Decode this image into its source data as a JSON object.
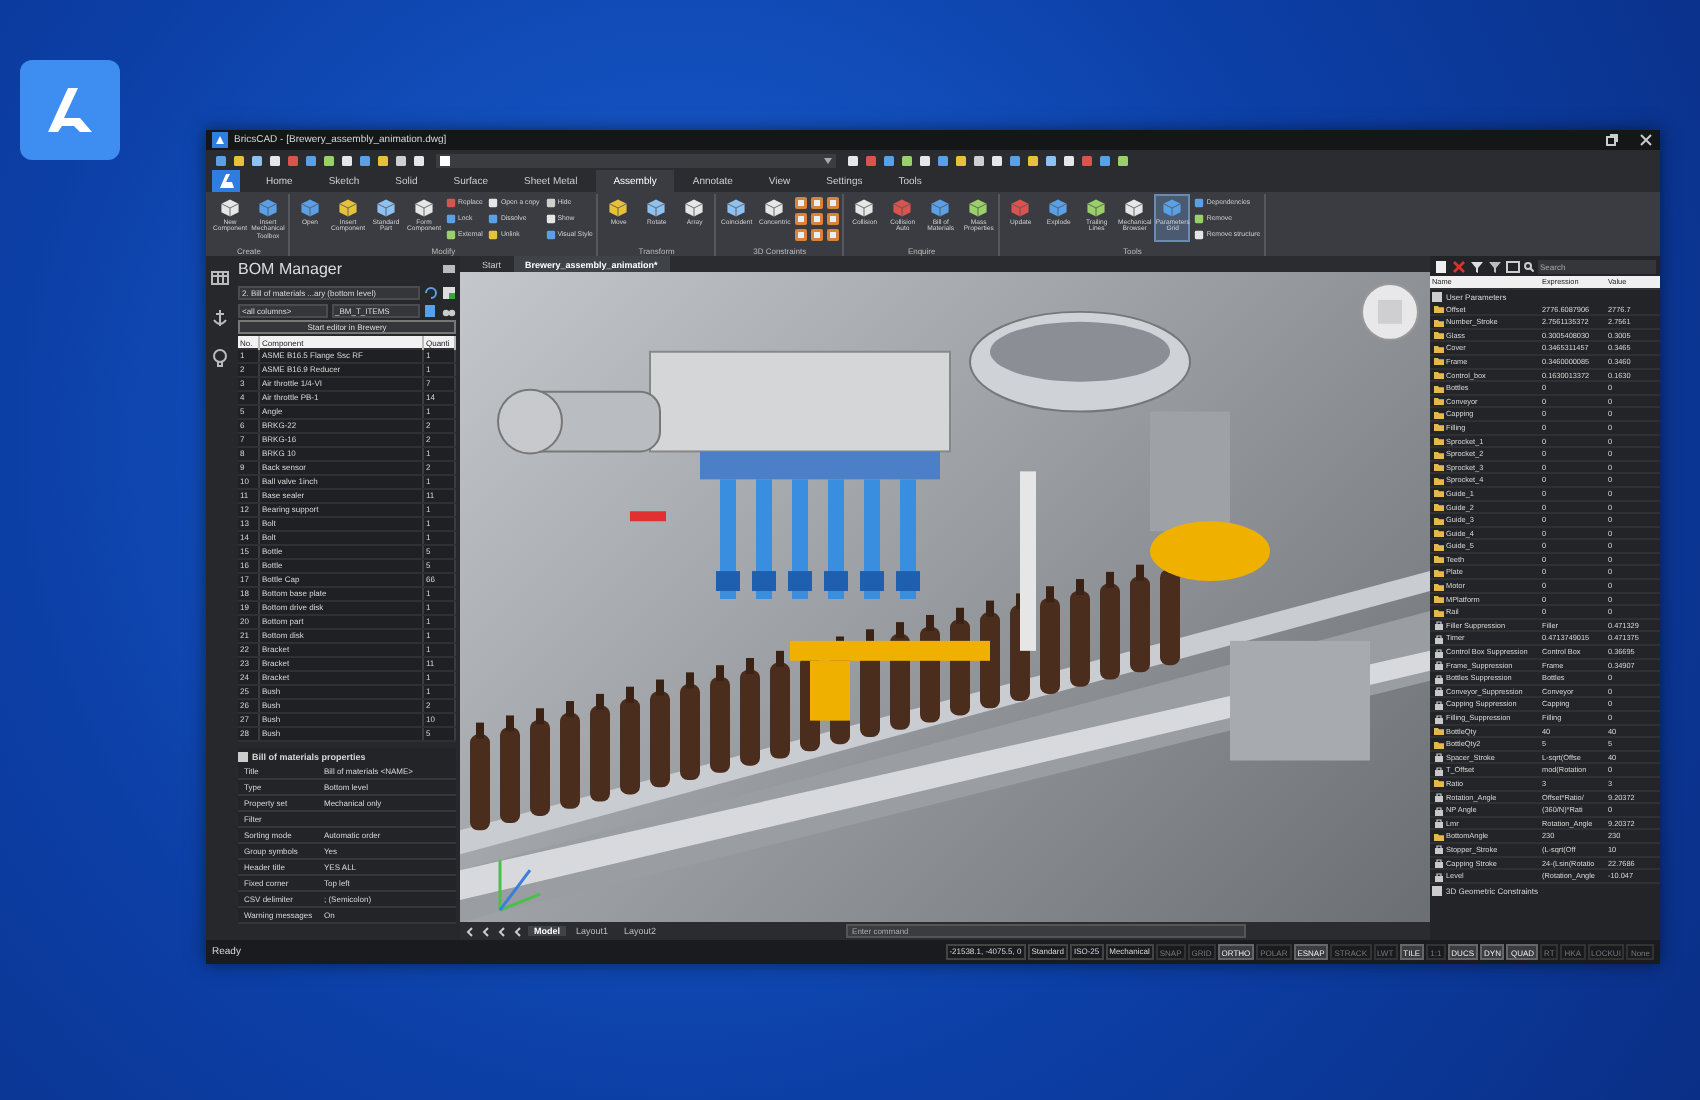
{
  "window": {
    "title": "BricsCAD - [Brewery_assembly_animation.dwg]"
  },
  "ribbon_tabs": [
    {
      "label": "Home",
      "selected": false
    },
    {
      "label": "Sketch",
      "selected": false
    },
    {
      "label": "Solid",
      "selected": false
    },
    {
      "label": "Surface",
      "selected": false
    },
    {
      "label": "Sheet Metal",
      "selected": false
    },
    {
      "label": "Assembly",
      "selected": true
    },
    {
      "label": "Annotate",
      "selected": false
    },
    {
      "label": "View",
      "selected": false
    },
    {
      "label": "Settings",
      "selected": false
    },
    {
      "label": "Tools",
      "selected": false
    }
  ],
  "ribbon_groups": [
    {
      "label": "Create",
      "items": [
        {
          "kind": "large",
          "label": "New Component"
        },
        {
          "kind": "large",
          "label": "Insert Mechanical Toolbox"
        }
      ]
    },
    {
      "label": "Modify",
      "items": [
        {
          "kind": "large",
          "label": "Open"
        },
        {
          "kind": "large",
          "label": "Insert Component"
        },
        {
          "kind": "large",
          "label": "Standard Part"
        },
        {
          "kind": "large",
          "label": "Form Component"
        },
        {
          "kind": "small",
          "label": "Replace"
        },
        {
          "kind": "small",
          "label": "Lock"
        },
        {
          "kind": "small",
          "label": "External"
        },
        {
          "kind": "small",
          "label": "Open a copy"
        },
        {
          "kind": "small",
          "label": "Dissolve"
        },
        {
          "kind": "small",
          "label": "Unlink"
        },
        {
          "kind": "small",
          "label": "Hide"
        },
        {
          "kind": "small",
          "label": "Show"
        },
        {
          "kind": "small",
          "label": "Visual Style"
        }
      ]
    },
    {
      "label": "Transform",
      "items": [
        {
          "kind": "large",
          "label": "Move"
        },
        {
          "kind": "large",
          "label": "Rotate"
        },
        {
          "kind": "large",
          "label": "Array"
        }
      ]
    },
    {
      "label": "3D Constraints",
      "items": [
        {
          "kind": "large",
          "label": "Coincident"
        },
        {
          "kind": "large",
          "label": "Concentric"
        },
        {
          "kind": "icon"
        },
        {
          "kind": "icon"
        },
        {
          "kind": "icon"
        },
        {
          "kind": "icon"
        },
        {
          "kind": "icon"
        },
        {
          "kind": "icon"
        },
        {
          "kind": "icon"
        },
        {
          "kind": "icon"
        },
        {
          "kind": "icon"
        }
      ]
    },
    {
      "label": "Enquire",
      "items": [
        {
          "kind": "large",
          "label": "Collision"
        },
        {
          "kind": "large",
          "label": "Collision Auto"
        },
        {
          "kind": "large",
          "label": "Bill of Materials"
        },
        {
          "kind": "large",
          "label": "Mass Properties"
        }
      ]
    },
    {
      "label": "Tools",
      "items": [
        {
          "kind": "large",
          "label": "Update",
          "selected": false
        },
        {
          "kind": "large",
          "label": "Explode",
          "selected": false
        },
        {
          "kind": "large",
          "label": "Trailing Lines",
          "selected": false
        },
        {
          "kind": "large",
          "label": "Mechanical Browser",
          "selected": false
        },
        {
          "kind": "large",
          "label": "Parameters Grid",
          "selected": true
        },
        {
          "kind": "small",
          "label": "Dependencies",
          "selected": false
        },
        {
          "kind": "small",
          "label": "Remove",
          "selected": false
        },
        {
          "kind": "small",
          "label": "Remove structure",
          "selected": false
        }
      ]
    }
  ],
  "document_tabs": [
    {
      "label": "Start",
      "selected": false
    },
    {
      "label": "Brewery_assembly_animation*",
      "selected": true
    }
  ],
  "bom_manager": {
    "title": "BOM Manager",
    "bom_select": "2. Bill of materials ...ary (bottom level)",
    "columns_select": "<all columns>",
    "items_select": "_BM_T_ITEMS",
    "editor_button": "Start editor in Brewery",
    "columns": [
      "No.",
      "Component",
      "Quanti"
    ],
    "rows": [
      [
        "1",
        "ASME B16.5 Flange Ssc RF",
        "1"
      ],
      [
        "2",
        "ASME B16.9 Reducer",
        "1"
      ],
      [
        "3",
        "Air throttle 1/4-VI",
        "7"
      ],
      [
        "4",
        "Air throttle PB-1",
        "14"
      ],
      [
        "5",
        "Angle",
        "1"
      ],
      [
        "6",
        "BRKG-22",
        "2"
      ],
      [
        "7",
        "BRKG-16",
        "2"
      ],
      [
        "8",
        "BRKG 10",
        "1"
      ],
      [
        "9",
        "Back sensor",
        "2"
      ],
      [
        "10",
        "Ball valve 1inch",
        "1"
      ],
      [
        "11",
        "Base sealer",
        "11"
      ],
      [
        "12",
        "Bearing support",
        "1"
      ],
      [
        "13",
        "Bolt",
        "1"
      ],
      [
        "14",
        "Bolt",
        "1"
      ],
      [
        "15",
        "Bottle",
        "5"
      ],
      [
        "16",
        "Bottle",
        "5"
      ],
      [
        "17",
        "Bottle Cap",
        "66"
      ],
      [
        "18",
        "Bottom base plate",
        "1"
      ],
      [
        "19",
        "Bottom drive disk",
        "1"
      ],
      [
        "20",
        "Bottom part",
        "1"
      ],
      [
        "21",
        "Bottom disk",
        "1"
      ],
      [
        "22",
        "Bracket",
        "1"
      ],
      [
        "23",
        "Bracket",
        "11"
      ],
      [
        "24",
        "Bracket",
        "1"
      ],
      [
        "25",
        "Bush",
        "1"
      ],
      [
        "26",
        "Bush",
        "2"
      ],
      [
        "27",
        "Bush",
        "10"
      ],
      [
        "28",
        "Bush",
        "5"
      ]
    ],
    "properties_title": "Bill of materials properties",
    "properties": [
      {
        "name": "Title",
        "value": "Bill of materials <NAME>"
      },
      {
        "name": "Type",
        "value": "Bottom level"
      },
      {
        "name": "Property set",
        "value": "Mechanical only"
      },
      {
        "name": "Filter"
      },
      {
        "name": "Sorting mode",
        "value": "Automatic order"
      },
      {
        "name": "Group symbols",
        "value": "Yes"
      },
      {
        "name": "Header title",
        "value": "YES ALL"
      },
      {
        "name": "Fixed corner",
        "value": "Top left"
      },
      {
        "name": "CSV delimiter",
        "value": "; (Semicolon)"
      },
      {
        "name": "Warning messages",
        "value": "On"
      }
    ]
  },
  "viewport": {
    "layout_tabs": [
      {
        "label": "Model",
        "selected": true
      },
      {
        "label": "Layout1",
        "selected": false
      },
      {
        "label": "Layout2",
        "selected": false
      }
    ],
    "command_placeholder": "Enter command"
  },
  "parameters": {
    "search_placeholder": "Search",
    "columns": [
      "Name",
      "Expression",
      "Value"
    ],
    "section": "User Parameters",
    "rows": [
      {
        "kind": "folder",
        "name": "Offset",
        "expression": "2776.6087906",
        "value": "2776.7"
      },
      {
        "kind": "folder",
        "name": "Number_Stroke",
        "expression": "2.7561135372",
        "value": "2.7561"
      },
      {
        "kind": "folder",
        "name": "Glass",
        "expression": "0.3005408030",
        "value": "0.3005"
      },
      {
        "kind": "folder",
        "name": "Cover",
        "expression": "0.3465311457",
        "value": "0.3465"
      },
      {
        "kind": "folder",
        "name": "Frame",
        "expression": "0.3460000085",
        "value": "0.3460"
      },
      {
        "kind": "folder",
        "name": "Control_box",
        "expression": "0.1630013372",
        "value": "0.1630"
      },
      {
        "kind": "folder",
        "name": "Bottles",
        "expression": "0",
        "value": "0"
      },
      {
        "kind": "folder",
        "name": "Conveyor",
        "expression": "0",
        "value": "0"
      },
      {
        "kind": "folder",
        "name": "Capping",
        "expression": "0",
        "value": "0"
      },
      {
        "kind": "folder",
        "name": "Filling",
        "expression": "0",
        "value": "0"
      },
      {
        "kind": "folder",
        "name": "Sprocket_1",
        "expression": "0",
        "value": "0"
      },
      {
        "kind": "folder",
        "name": "Sprocket_2",
        "expression": "0",
        "value": "0"
      },
      {
        "kind": "folder",
        "name": "Sprocket_3",
        "expression": "0",
        "value": "0"
      },
      {
        "kind": "folder",
        "name": "Sprocket_4",
        "expression": "0",
        "value": "0"
      },
      {
        "kind": "folder",
        "name": "Guide_1",
        "expression": "0",
        "value": "0"
      },
      {
        "kind": "folder",
        "name": "Guide_2",
        "expression": "0",
        "value": "0"
      },
      {
        "kind": "folder",
        "name": "Guide_3",
        "expression": "0",
        "value": "0"
      },
      {
        "kind": "folder",
        "name": "Guide_4",
        "expression": "0",
        "value": "0"
      },
      {
        "kind": "folder",
        "name": "Guide_5",
        "expression": "0",
        "value": "0"
      },
      {
        "kind": "folder",
        "name": "Teeth",
        "expression": "0",
        "value": "0"
      },
      {
        "kind": "folder",
        "name": "Plate",
        "expression": "0",
        "value": "0"
      },
      {
        "kind": "folder",
        "name": "Motor",
        "expression": "0",
        "value": "0"
      },
      {
        "kind": "folder",
        "name": "MPlatform",
        "expression": "0",
        "value": "0"
      },
      {
        "kind": "folder",
        "name": "Rail",
        "expression": "0",
        "value": "0"
      },
      {
        "kind": "locked",
        "name": "Filler Suppression",
        "expression": "Filler",
        "value": "0.471329"
      },
      {
        "kind": "locked",
        "name": "Timer",
        "expression": "0.4713749015",
        "value": "0.471375"
      },
      {
        "kind": "locked",
        "name": "Control Box Suppression",
        "expression": "Control Box",
        "value": "0.36695"
      },
      {
        "kind": "locked",
        "name": "Frame_Suppression",
        "expression": "Frame",
        "value": "0.34907"
      },
      {
        "kind": "locked",
        "name": "Bottles Suppression",
        "expression": "Bottles",
        "value": "0"
      },
      {
        "kind": "locked",
        "name": "Conveyor_Suppression",
        "expression": "Conveyor",
        "value": "0"
      },
      {
        "kind": "locked",
        "name": "Capping Suppression",
        "expression": "Capping",
        "value": "0"
      },
      {
        "kind": "locked",
        "name": "Filling_Suppression",
        "expression": "Filling",
        "value": "0"
      },
      {
        "kind": "folder",
        "name": "BottleQty",
        "expression": "40",
        "value": "40"
      },
      {
        "kind": "folder",
        "name": "BottleQty2",
        "expression": "5",
        "value": "5"
      },
      {
        "kind": "locked",
        "name": "Spacer_Stroke",
        "expression": "L-sqrt(Offse",
        "value": "40"
      },
      {
        "kind": "locked",
        "name": "T_Offset",
        "expression": "mod(Rotation",
        "value": "0"
      },
      {
        "kind": "folder",
        "name": "Ratio",
        "expression": "3",
        "value": "3"
      },
      {
        "kind": "locked",
        "name": "Rotation_Angle",
        "expression": "Offset*Ratio/",
        "value": "9.20372"
      },
      {
        "kind": "locked",
        "name": "NP Angle",
        "expression": "(360/N)*Rati",
        "value": "0"
      },
      {
        "kind": "locked",
        "name": "Lmr",
        "expression": "Rotation_Angle",
        "value": "9.20372"
      },
      {
        "kind": "folder",
        "name": "BottomAngle",
        "expression": "230",
        "value": "230"
      },
      {
        "kind": "locked",
        "name": "Stopper_Stroke",
        "expression": "(L-sqrt(Off",
        "value": "10"
      },
      {
        "kind": "locked",
        "name": "Capping Stroke",
        "expression": "24-(Lsin(Rotatio",
        "value": "22.7686"
      },
      {
        "kind": "locked",
        "name": "Level",
        "expression": "(Rotation_Angle",
        "value": "-10.047"
      }
    ],
    "section_2": "3D Geometric Constraints"
  },
  "status_bar": {
    "message": "Ready",
    "fields": [
      "-21538.1, -4075.5, 0",
      "Standard",
      "ISO-25",
      "Mechanical"
    ],
    "toggles": [
      {
        "label": "SNAP",
        "on": false
      },
      {
        "label": "GRID",
        "on": false
      },
      {
        "label": "ORTHO",
        "on": true
      },
      {
        "label": "POLAR",
        "on": false
      },
      {
        "label": "ESNAP",
        "on": true
      },
      {
        "label": "STRACK",
        "on": false
      },
      {
        "label": "LWT",
        "on": false
      },
      {
        "label": "TILE",
        "on": true
      },
      {
        "label": "1:1",
        "on": false
      },
      {
        "label": "DUCS",
        "on": true
      },
      {
        "label": "DYN",
        "on": true
      },
      {
        "label": "QUAD",
        "on": true
      },
      {
        "label": "RT",
        "on": false
      },
      {
        "label": "HKA",
        "on": false
      },
      {
        "label": "LOCKUI",
        "on": false
      },
      {
        "label": "None",
        "on": false
      }
    ]
  }
}
